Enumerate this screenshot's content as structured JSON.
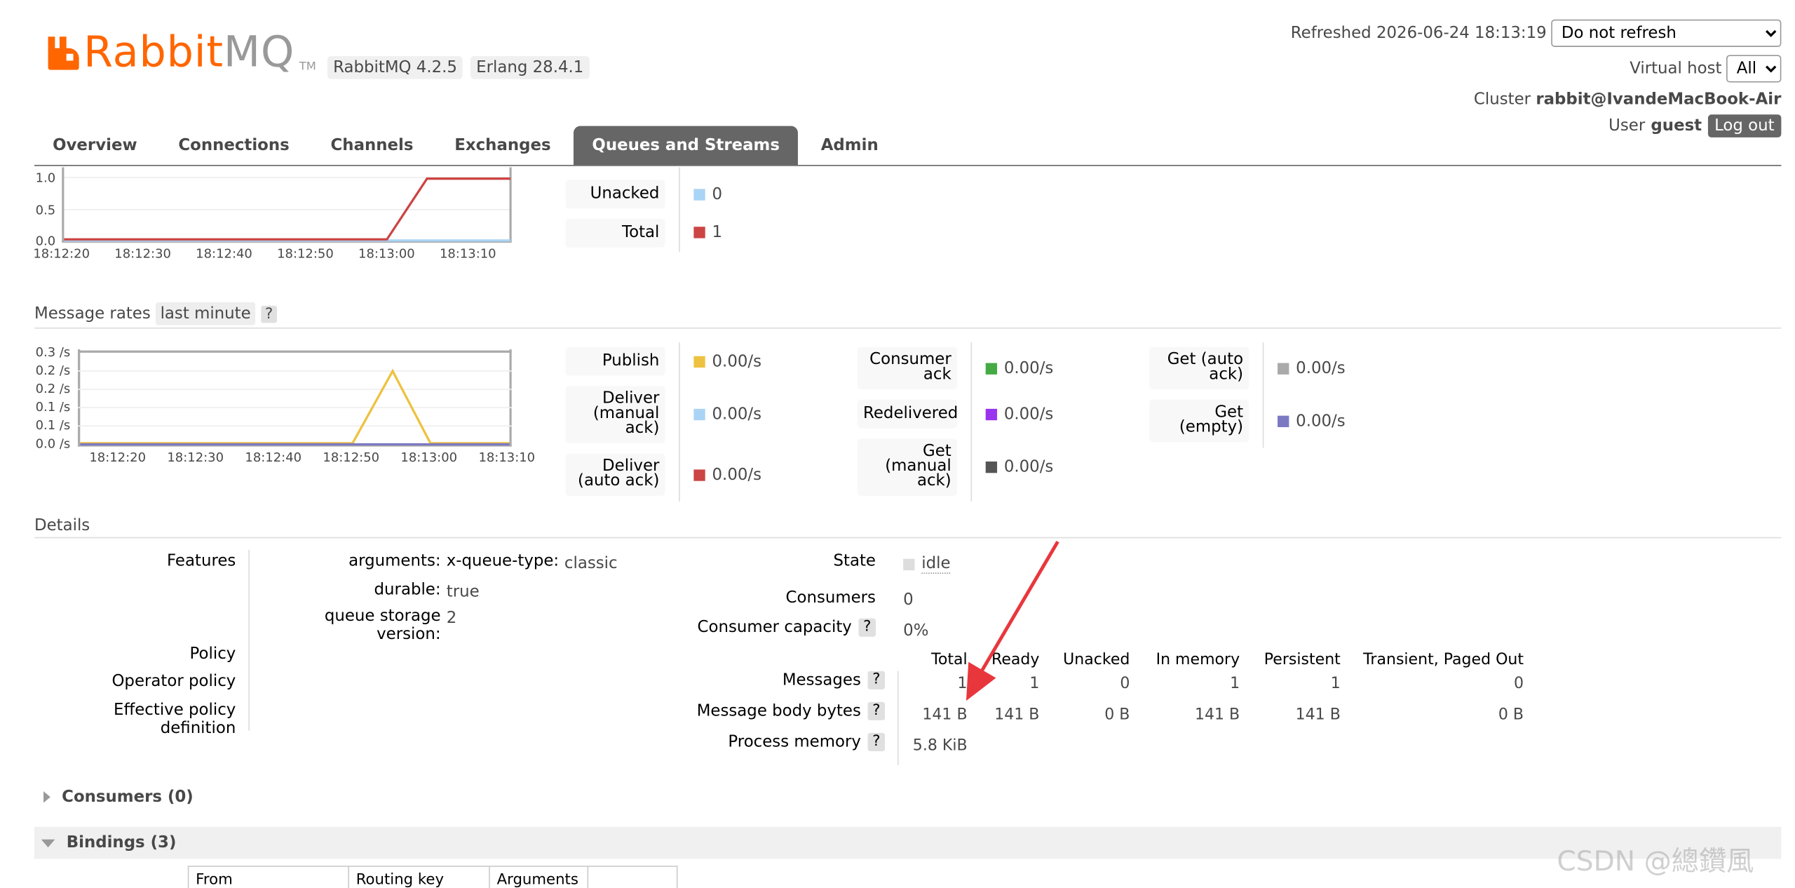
{
  "header": {
    "logo_rabbit": "Rabbit",
    "logo_mq": "MQ",
    "logo_tm": "TM",
    "rabbitmq_version": "RabbitMQ 4.2.5",
    "erlang_version": "Erlang 28.4.1",
    "refreshed_label": "Refreshed 2026-06-24 18:13:19",
    "refresh_option": "Do not refresh",
    "vhost_label": "Virtual host",
    "vhost_value": "All",
    "cluster_label": "Cluster",
    "cluster_value": "rabbit@IvandeMacBook-Air",
    "user_label": "User",
    "user_value": "guest",
    "logout_label": "Log out"
  },
  "tabs": [
    {
      "label": "Overview",
      "active": false
    },
    {
      "label": "Connections",
      "active": false
    },
    {
      "label": "Channels",
      "active": false
    },
    {
      "label": "Exchanges",
      "active": false
    },
    {
      "label": "Queues and Streams",
      "active": true
    },
    {
      "label": "Admin",
      "active": false
    }
  ],
  "queued_chart": {
    "y_ticks": [
      "1.0",
      "0.5",
      "0.0"
    ],
    "x_ticks": [
      "18:12:20",
      "18:12:30",
      "18:12:40",
      "18:12:50",
      "18:13:00",
      "18:13:10"
    ],
    "legend": [
      {
        "label": "Unacked",
        "value": "0",
        "color": "#aad4f5"
      },
      {
        "label": "Total",
        "value": "1",
        "color": "#cc4444"
      }
    ]
  },
  "rates": {
    "title": "Message rates",
    "range": "last minute",
    "help": "?",
    "y_ticks": [
      "0.3 /s",
      "0.2 /s",
      "0.2 /s",
      "0.1 /s",
      "0.1 /s",
      "0.0 /s"
    ],
    "x_ticks": [
      "18:12:20",
      "18:12:30",
      "18:12:40",
      "18:12:50",
      "18:13:00",
      "18:13:10"
    ],
    "col1": [
      {
        "label": "Publish",
        "value": "0.00/s",
        "color": "#edc240"
      },
      {
        "label": "Deliver (manual ack)",
        "value": "0.00/s",
        "color": "#aad4f5"
      },
      {
        "label": "Deliver (auto ack)",
        "value": "0.00/s",
        "color": "#cc4444"
      }
    ],
    "col2": [
      {
        "label": "Consumer ack",
        "value": "0.00/s",
        "color": "#44aa44"
      },
      {
        "label": "Redelivered",
        "value": "0.00/s",
        "color": "#9933ee"
      },
      {
        "label": "Get (manual ack)",
        "value": "0.00/s",
        "color": "#555555"
      }
    ],
    "col3": [
      {
        "label": "Get (auto ack)",
        "value": "0.00/s",
        "color": "#aaaaaa"
      },
      {
        "label": "Get (empty)",
        "value": "0.00/s",
        "color": "#7c79c3"
      }
    ]
  },
  "details": {
    "title": "Details",
    "features_label": "Features",
    "arguments_label": "arguments:",
    "arg_key": "x-queue-type:",
    "arg_value": "classic",
    "durable_label": "durable:",
    "durable_value": "true",
    "storage_label": "queue storage version:",
    "storage_value": "2",
    "policy_label": "Policy",
    "operator_policy_label": "Operator policy",
    "effective_policy_label": "Effective policy definition",
    "state_label": "State",
    "state_value": "idle",
    "consumers_label": "Consumers",
    "consumers_value": "0",
    "capacity_label": "Consumer capacity",
    "capacity_value": "0%",
    "help": "?",
    "columns": [
      "Total",
      "Ready",
      "Unacked",
      "In memory",
      "Persistent",
      "Transient, Paged Out"
    ],
    "messages_label": "Messages",
    "messages": [
      "1",
      "1",
      "0",
      "1",
      "1",
      "0"
    ],
    "body_bytes_label": "Message body bytes",
    "body_bytes": [
      "141 B",
      "141 B",
      "0 B",
      "141 B",
      "141 B",
      "0 B"
    ],
    "process_memory_label": "Process memory",
    "process_memory_value": "5.8 KiB"
  },
  "sections": {
    "consumers": "Consumers (0)",
    "bindings": "Bindings (3)"
  },
  "bindings_table": {
    "columns": [
      "From",
      "Routing key",
      "Arguments",
      ""
    ]
  },
  "watermark": "CSDN @總鑽風"
}
